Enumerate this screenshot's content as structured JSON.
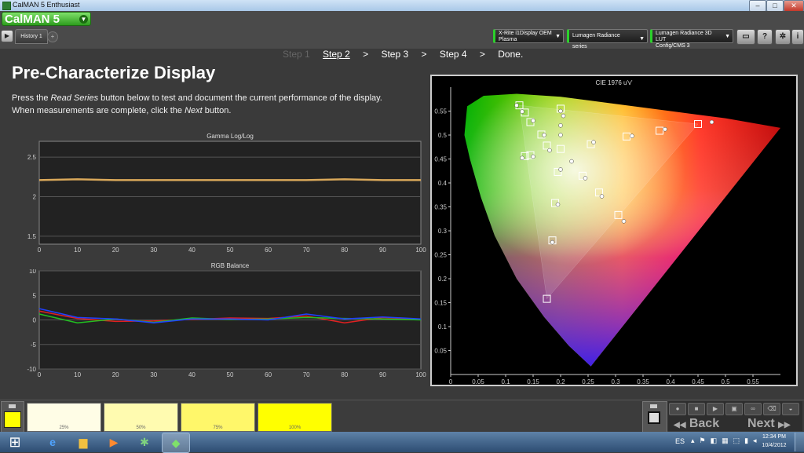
{
  "window": {
    "title": "CalMAN 5 Enthusiast",
    "minimize": "–",
    "maximize": "□",
    "close": "✕"
  },
  "header": {
    "logo": "CalMAN 5",
    "tab_label": "History 1",
    "devices": [
      {
        "line1": "X-Rite i1Display OEM",
        "line2": "Plasma"
      },
      {
        "line1": "Lumagen Radiance series",
        "line2": ""
      },
      {
        "line1": "Lumagen Radiance 3D LUT",
        "line2": "Config/CMS 3"
      }
    ],
    "icons": [
      "monitor-icon",
      "help-icon",
      "gear-icon",
      "info-icon"
    ]
  },
  "steps": [
    "Step 1",
    "Step 2",
    "Step 3",
    "Step 4",
    "Done."
  ],
  "steps_sep": ">",
  "page": {
    "title": "Pre-Characterize Display",
    "instr1_a": "Press the ",
    "instr1_em": "Read Series",
    "instr1_b": " button below to test and document the current performance of the display.",
    "instr2_a": "When measurements are complete, click the ",
    "instr2_em": "Next",
    "instr2_b": " button."
  },
  "chart_data": [
    {
      "type": "line",
      "title": "Gamma Log/Log",
      "x": [
        0,
        10,
        20,
        30,
        40,
        50,
        60,
        70,
        80,
        90,
        100
      ],
      "xlim": [
        0,
        100
      ],
      "ylim": [
        1.4,
        2.7
      ],
      "yticks": [
        1.5,
        2,
        2.5
      ],
      "series": [
        {
          "values": [
            2.21,
            2.22,
            2.21,
            2.21,
            2.21,
            2.21,
            2.21,
            2.21,
            2.22,
            2.21,
            2.21
          ],
          "color": "#d9a85a"
        }
      ]
    },
    {
      "type": "line",
      "title": "RGB Balance",
      "x": [
        0,
        10,
        20,
        30,
        40,
        50,
        60,
        70,
        80,
        90,
        100
      ],
      "xlim": [
        0,
        100
      ],
      "ylim": [
        -10,
        10
      ],
      "yticks": [
        -10,
        -5,
        0,
        5,
        10
      ],
      "series": [
        {
          "values": [
            1.8,
            0.3,
            -0.3,
            -0.2,
            0.1,
            0.4,
            0.3,
            0.8,
            -0.6,
            0.5,
            0.1
          ],
          "color": "#e02020"
        },
        {
          "values": [
            1.2,
            -0.6,
            0.2,
            -0.5,
            0.4,
            0.1,
            0.2,
            0.5,
            0.3,
            0.2,
            0.0
          ],
          "color": "#20c020"
        },
        {
          "values": [
            2.3,
            0.5,
            0.2,
            -0.6,
            0.2,
            0.2,
            0.0,
            1.2,
            0.2,
            0.6,
            0.2
          ],
          "color": "#2040ff"
        }
      ]
    },
    {
      "type": "scatter",
      "title": "CIE 1976 u'v'",
      "xlim": [
        0,
        0.6
      ],
      "ylim": [
        0,
        0.6
      ],
      "xticks": [
        0,
        0.05,
        0.1,
        0.15,
        0.2,
        0.25,
        0.3,
        0.35,
        0.4,
        0.45,
        0.5,
        0.55
      ],
      "yticks": [
        0.05,
        0.1,
        0.15,
        0.2,
        0.25,
        0.3,
        0.35,
        0.4,
        0.45,
        0.5,
        0.55
      ],
      "targets": [
        [
          0.125,
          0.562
        ],
        [
          0.135,
          0.547
        ],
        [
          0.145,
          0.527
        ],
        [
          0.165,
          0.501
        ],
        [
          0.175,
          0.478
        ],
        [
          0.2,
          0.555
        ],
        [
          0.2,
          0.471
        ],
        [
          0.255,
          0.481
        ],
        [
          0.32,
          0.497
        ],
        [
          0.38,
          0.509
        ],
        [
          0.45,
          0.523
        ],
        [
          0.135,
          0.456
        ],
        [
          0.145,
          0.458
        ],
        [
          0.195,
          0.423
        ],
        [
          0.24,
          0.415
        ],
        [
          0.27,
          0.38
        ],
        [
          0.19,
          0.358
        ],
        [
          0.305,
          0.333
        ],
        [
          0.185,
          0.28
        ],
        [
          0.175,
          0.158
        ]
      ],
      "measured": [
        [
          0.12,
          0.562
        ],
        [
          0.13,
          0.549
        ],
        [
          0.15,
          0.53
        ],
        [
          0.17,
          0.5
        ],
        [
          0.18,
          0.468
        ],
        [
          0.2,
          0.55
        ],
        [
          0.205,
          0.54
        ],
        [
          0.2,
          0.52
        ],
        [
          0.2,
          0.5
        ],
        [
          0.26,
          0.485
        ],
        [
          0.33,
          0.498
        ],
        [
          0.39,
          0.512
        ],
        [
          0.475,
          0.527
        ],
        [
          0.13,
          0.452
        ],
        [
          0.15,
          0.455
        ],
        [
          0.2,
          0.428
        ],
        [
          0.22,
          0.445
        ],
        [
          0.245,
          0.41
        ],
        [
          0.275,
          0.372
        ],
        [
          0.195,
          0.355
        ],
        [
          0.315,
          0.32
        ],
        [
          0.185,
          0.276
        ]
      ]
    }
  ],
  "swatches": [
    {
      "label": "25%",
      "color": "#fffde6"
    },
    {
      "label": "50%",
      "color": "#fffbb0"
    },
    {
      "label": "75%",
      "color": "#fff76a"
    },
    {
      "label": "100%",
      "color": "#ffff00"
    }
  ],
  "controls": {
    "back": "Back",
    "next": "Next",
    "back_arrow": "◀◀",
    "next_arrow": "▶▶"
  },
  "taskbar": {
    "lang": "ES",
    "time": "12:34 PM",
    "date": "10/4/2012",
    "start": "⊞"
  }
}
